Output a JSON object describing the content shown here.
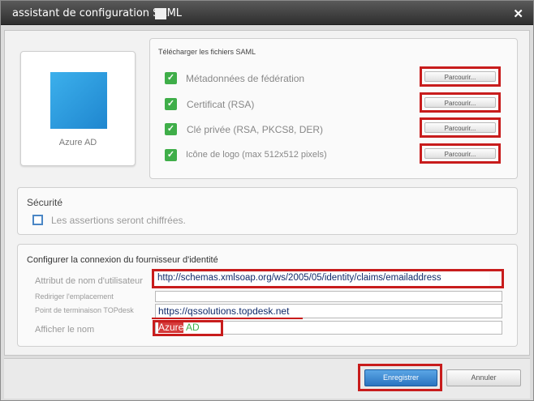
{
  "dialog": {
    "title": "assistant de configuration SAML",
    "close_icon": "close-icon"
  },
  "provider_card": {
    "label": "Azure AD",
    "logo_icon": "azure-ad-logo-icon",
    "logo_color": "#2b9ae0"
  },
  "upload": {
    "title": "Télécharger les fichiers SAML",
    "check_icon": "checkmark-icon",
    "items": [
      {
        "label": "Métadonnées de fédération",
        "button": "Parcourir..."
      },
      {
        "label": "Certificat (RSA)",
        "button": "Parcourir..."
      },
      {
        "label": "Clé privée (RSA, PKCS8, DER)",
        "button": "Parcourir..."
      },
      {
        "label": "Icône de logo (max 512x512 pixels)",
        "button": "Parcourir..."
      }
    ]
  },
  "security": {
    "title": "Sécurité",
    "checkbox_label": "Les assertions seront chiffrées.",
    "checked": false
  },
  "idp": {
    "title": "Configurer la connexion du fournisseur d'identité",
    "fields": [
      {
        "label": "Attribut de nom d'utilisateur",
        "value": "http://schemas.xmlsoap.org/ws/2005/05/identity/claims/emailaddress"
      },
      {
        "label": "Rediriger l'emplacement",
        "value": ""
      },
      {
        "label": "Point de terminaison TOPdesk",
        "value": "https://qssolutions.topdesk.net"
      },
      {
        "label": "Afficher le nom",
        "value_part1": "Azure",
        "value_part2": " AD"
      }
    ]
  },
  "footer": {
    "save": "Enregistrer",
    "cancel": "Annuler"
  },
  "colors": {
    "highlight": "#c81c1c",
    "check": "#3fae49",
    "primary_button": "#2a74c0",
    "titlebar": "#3a3a3a"
  }
}
